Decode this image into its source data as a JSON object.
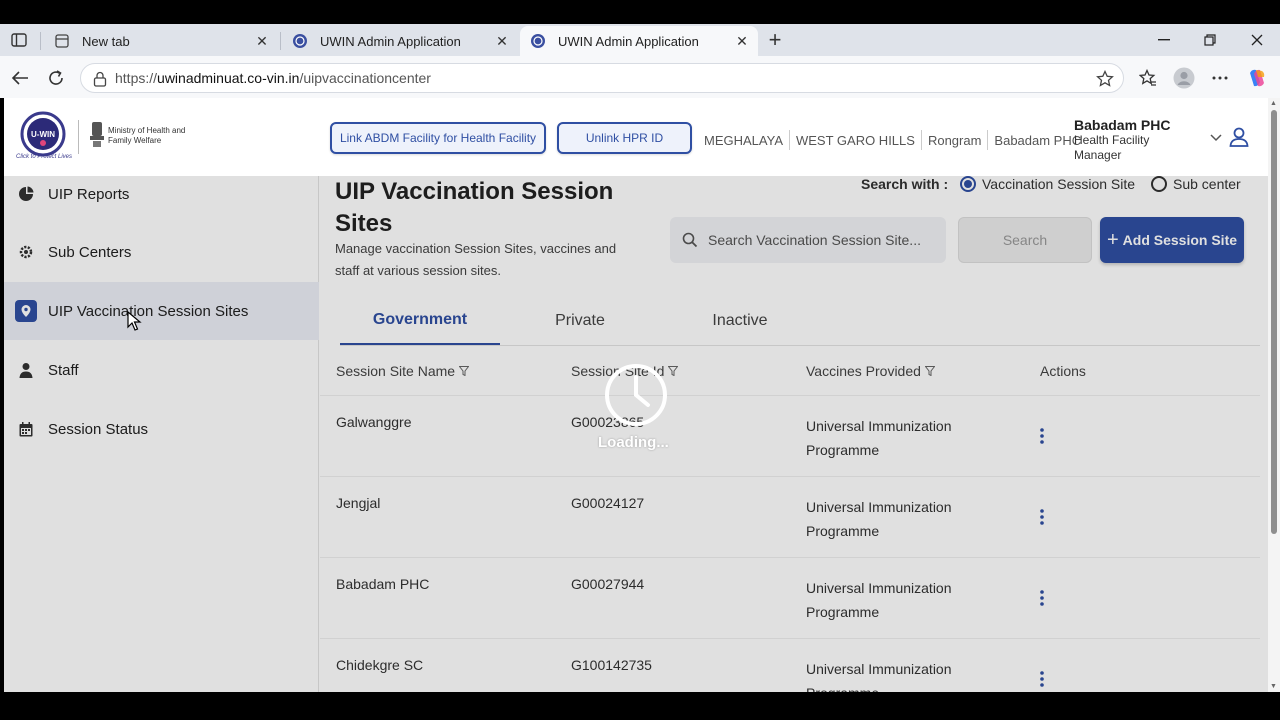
{
  "browser": {
    "tabs": [
      {
        "label": "New tab",
        "active": false
      },
      {
        "label": "UWIN Admin Application",
        "active": false
      },
      {
        "label": "UWIN Admin Application",
        "active": true
      }
    ],
    "url_prefix": "https://",
    "url_host": "uwinadminuat.co-vin.in",
    "url_path": "/uipvaccinationcenter"
  },
  "header": {
    "logo_text": "U-WIN",
    "logo_tagline": "Click to Protect Lives",
    "ministry": "Ministry of Health and Family Welfare",
    "btn_link_abdm": "Link ABDM Facility for Health Facility",
    "btn_unlink_hpr": "Unlink HPR ID",
    "crumbs": [
      "MEGHALAYA",
      "WEST GARO HILLS",
      "Rongram",
      "Babadam PHC"
    ],
    "user_name": "Babadam PHC",
    "user_role": "Health Facility Manager"
  },
  "sidebar": {
    "items": [
      {
        "label": "UIP Reports",
        "icon": "pie-chart-icon",
        "active": false
      },
      {
        "label": "Sub Centers",
        "icon": "gear-icon",
        "active": false
      },
      {
        "label": "UIP Vaccination Session Sites",
        "icon": "location-pin-icon",
        "active": true
      },
      {
        "label": "Staff",
        "icon": "person-icon",
        "active": false
      },
      {
        "label": "Session Status",
        "icon": "calendar-icon",
        "active": false
      }
    ]
  },
  "main": {
    "title": "UIP Vaccination Session Sites",
    "description": "Manage vaccination Session Sites, vaccines and staff at various session sites.",
    "search_with_label": "Search with :",
    "radio_options": [
      {
        "label": "Vaccination Session Site",
        "selected": true
      },
      {
        "label": "Sub center",
        "selected": false
      }
    ],
    "search_placeholder": "Search Vaccination Session Site...",
    "search_button": "Search",
    "add_button": "Add Session Site",
    "tabs": [
      {
        "label": "Government",
        "active": true
      },
      {
        "label": "Private",
        "active": false
      },
      {
        "label": "Inactive",
        "active": false
      }
    ],
    "columns": [
      "Session Site Name",
      "Session Site Id",
      "Vaccines Provided",
      "Actions"
    ],
    "rows": [
      {
        "name": "Galwanggre",
        "id": "G00023865",
        "vaccines": "Universal Immunization Programme"
      },
      {
        "name": "Jengjal",
        "id": "G00024127",
        "vaccines": "Universal Immunization Programme"
      },
      {
        "name": "Babadam PHC",
        "id": "G00027944",
        "vaccines": "Universal Immunization Programme"
      },
      {
        "name": "Chidekgre SC",
        "id": "G100142735",
        "vaccines": "Universal Immunization Programme"
      }
    ],
    "loading_text": "Loading..."
  },
  "colors": {
    "accent": "#2f4fa3"
  }
}
